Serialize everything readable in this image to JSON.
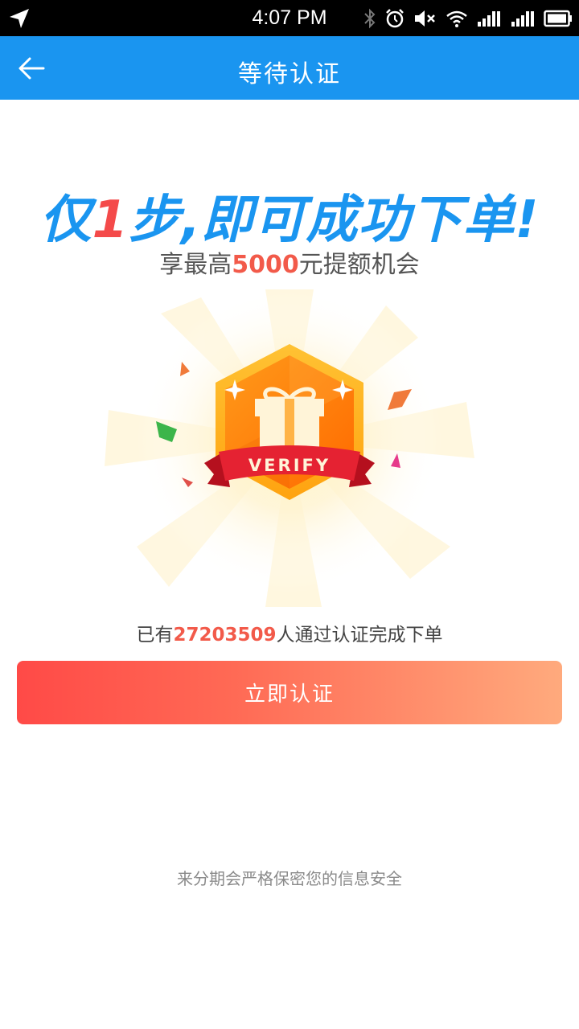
{
  "status_bar": {
    "time": "4:07 PM",
    "icons": [
      "navigation-icon",
      "bluetooth-icon",
      "alarm-icon",
      "mute-icon",
      "wifi-icon",
      "signal-icon",
      "signal-icon",
      "battery-icon"
    ]
  },
  "app_bar": {
    "title": "等待认证",
    "back_icon": "back-arrow-icon"
  },
  "headline": {
    "prefix": "仅",
    "number": "1",
    "suffix": "步,即可成功下单!"
  },
  "subline": {
    "prefix": "享最高",
    "amount": "5000",
    "suffix": "元提额机会"
  },
  "badge": {
    "label": "VERIFY",
    "icon": "gift-icon"
  },
  "stats": {
    "prefix": "已有",
    "count": "27203509",
    "suffix": "人通过认证完成下单"
  },
  "verify_button": {
    "label": "立即认证"
  },
  "privacy_note": "来分期会严格保密您的信息安全",
  "colors": {
    "primary_blue": "#1a95f0",
    "accent_red": "#f25a4a",
    "button_start": "#ff4a47",
    "button_end": "#ffaa7d"
  }
}
